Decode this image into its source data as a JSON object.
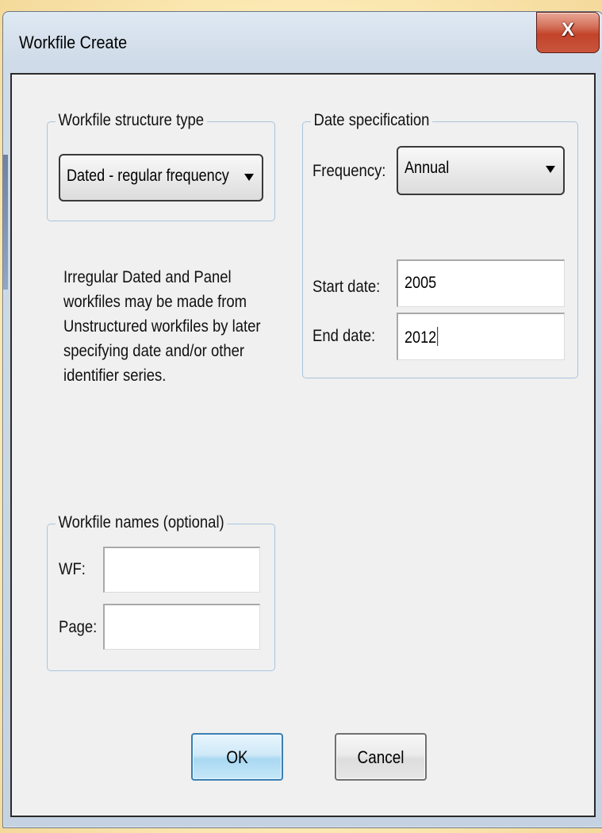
{
  "window": {
    "title": "Workfile Create",
    "close_glyph": "X"
  },
  "structure_group": {
    "label": "Workfile structure type",
    "selected_value": "Dated - regular frequency",
    "note": "Irregular Dated and Panel workfiles may be made from Unstructured workfiles by later specifying date and/or other identifier series."
  },
  "date_group": {
    "label": "Date specification",
    "frequency_label": "Frequency:",
    "frequency_value": "Annual",
    "start_label": "Start date:",
    "start_value": "2005",
    "end_label": "End date:",
    "end_value": "2012"
  },
  "names_group": {
    "label": "Workfile names (optional)",
    "wf_label": "WF:",
    "wf_value": "",
    "page_label": "Page:",
    "page_value": ""
  },
  "buttons": {
    "ok": "OK",
    "cancel": "Cancel"
  },
  "icons": {
    "close": "close-icon",
    "dropdown": "chevron-down-icon"
  },
  "colors": {
    "background": "#fbe9b7",
    "close_button": "#c2432a",
    "group_border": "#a7c5de",
    "ok_button": "#a9d8f2"
  }
}
